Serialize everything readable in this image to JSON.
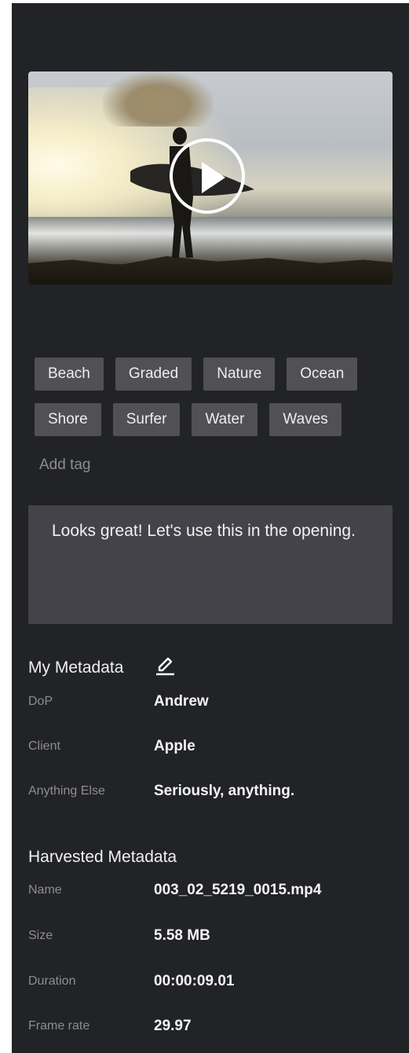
{
  "video": {
    "thumbnail_description": "surfer-on-rocks-at-sunset",
    "play_icon": "play-icon"
  },
  "tags": {
    "rows": [
      [
        "Beach",
        "Graded",
        "Nature",
        "Ocean"
      ],
      [
        "Shore",
        "Surfer",
        "Water",
        "Waves"
      ]
    ],
    "add_label": "Add tag"
  },
  "comment": {
    "text": "Looks great! Let's use this in the opening."
  },
  "my_metadata": {
    "title": "My Metadata",
    "edit_icon": "pencil-icon",
    "fields": [
      {
        "key": "DoP",
        "value": "Andrew"
      },
      {
        "key": "Client",
        "value": "Apple"
      },
      {
        "key": "Anything Else",
        "value": "Seriously, anything."
      }
    ]
  },
  "harvested_metadata": {
    "title": "Harvested Metadata",
    "fields": [
      {
        "key": "Name",
        "value": "003_02_5219_0015.mp4"
      },
      {
        "key": "Size",
        "value": "5.58 MB"
      },
      {
        "key": "Duration",
        "value": "00:00:09.01"
      },
      {
        "key": "Frame rate",
        "value": "29.97"
      }
    ]
  },
  "colors": {
    "panel_bg": "#222327",
    "tag_bg": "#505055",
    "comment_bg": "#434349"
  }
}
